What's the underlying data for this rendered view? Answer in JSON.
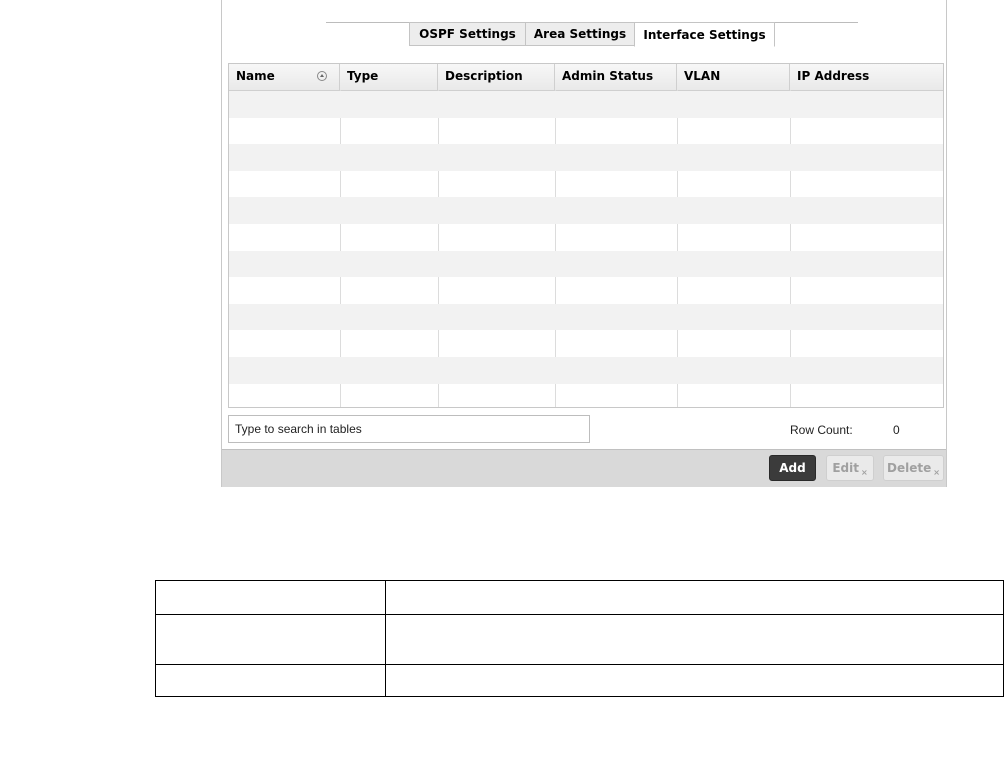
{
  "tabs": [
    {
      "label": "OSPF Settings",
      "active": false
    },
    {
      "label": "Area Settings",
      "active": false
    },
    {
      "label": "Interface Settings",
      "active": true
    }
  ],
  "table": {
    "columns": [
      "Name",
      "Type",
      "Description",
      "Admin Status",
      "VLAN",
      "IP Address"
    ],
    "sorted_column": "Name",
    "sort_direction": "ascending",
    "rows": []
  },
  "search": {
    "placeholder": "Type to search in tables"
  },
  "row_count": {
    "label": "Row Count:",
    "value": "0"
  },
  "buttons": {
    "add": "Add",
    "edit": "Edit",
    "delete": "Delete"
  },
  "colors": {
    "footer_bg": "#d9d9d9",
    "add_button_bg": "#3b3b3b",
    "disabled_text": "#a0a0a0"
  }
}
